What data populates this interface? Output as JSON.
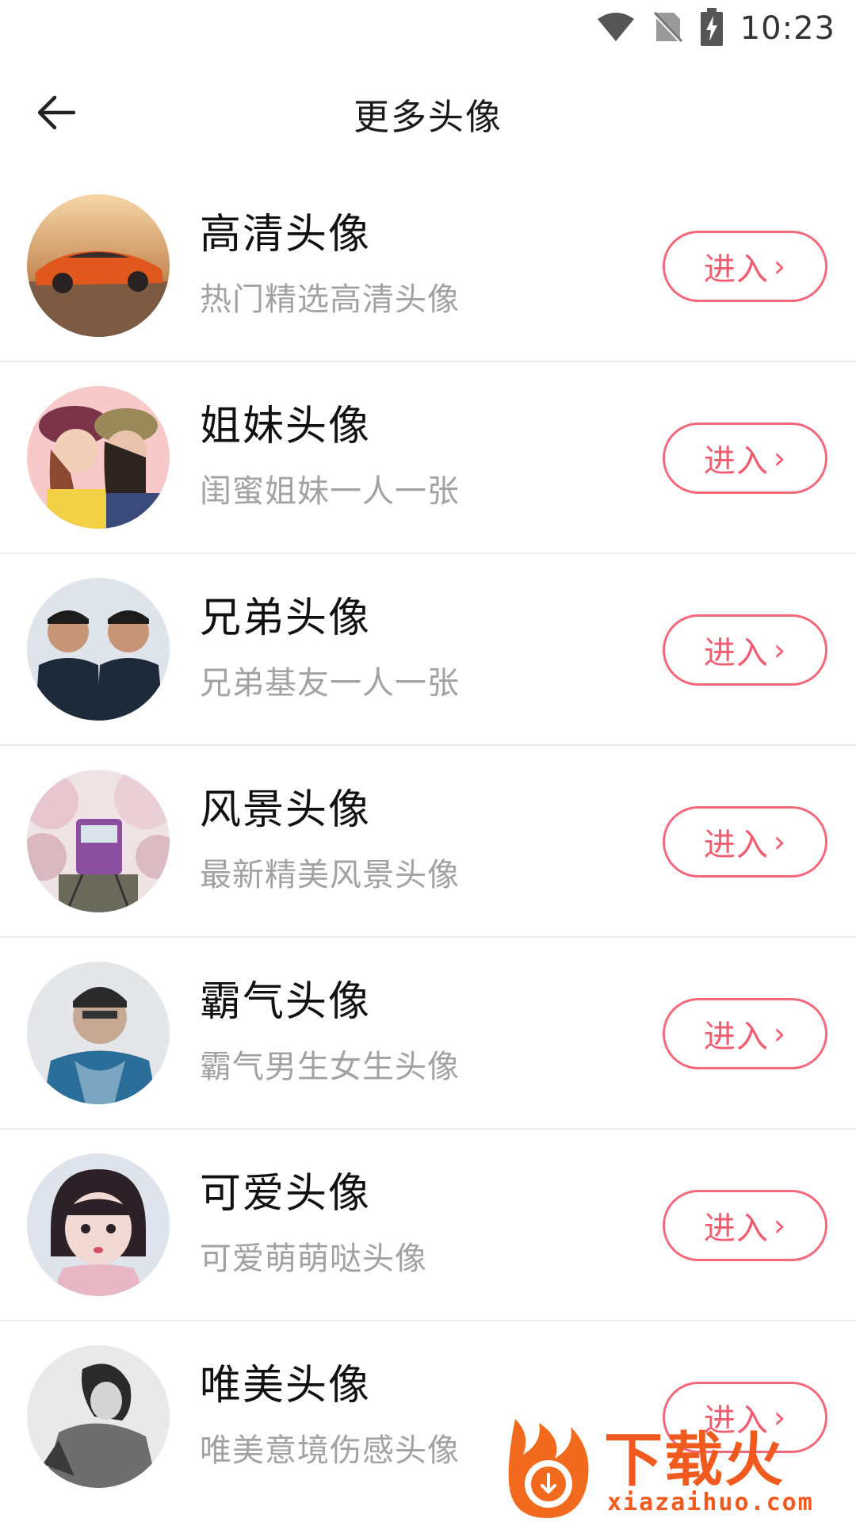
{
  "status_bar": {
    "time": "10:23",
    "icons": [
      "wifi-icon",
      "no-sim-icon",
      "battery-charging-icon"
    ]
  },
  "header": {
    "title": "更多头像",
    "back_icon": "back-arrow-icon"
  },
  "accent_color": "#f25c70",
  "items": [
    {
      "title": "高清头像",
      "subtitle": "热门精选高清头像",
      "button": "进入",
      "thumbnail": "sports-car"
    },
    {
      "title": "姐妹头像",
      "subtitle": "闺蜜姐妹一人一张",
      "button": "进入",
      "thumbnail": "two-girls"
    },
    {
      "title": "兄弟头像",
      "subtitle": "兄弟基友一人一张",
      "button": "进入",
      "thumbnail": "two-men"
    },
    {
      "title": "风景头像",
      "subtitle": "最新精美风景头像",
      "button": "进入",
      "thumbnail": "train-cherry-blossom"
    },
    {
      "title": "霸气头像",
      "subtitle": "霸气男生女生头像",
      "button": "进入",
      "thumbnail": "cool-portrait"
    },
    {
      "title": "可爱头像",
      "subtitle": "可爱萌萌哒头像",
      "button": "进入",
      "thumbnail": "cute-girl"
    },
    {
      "title": "唯美头像",
      "subtitle": "唯美意境伤感头像",
      "button": "进入",
      "thumbnail": "bw-girl"
    }
  ],
  "watermark": {
    "brand": "下载火",
    "url": "xiazaihuo.com"
  }
}
